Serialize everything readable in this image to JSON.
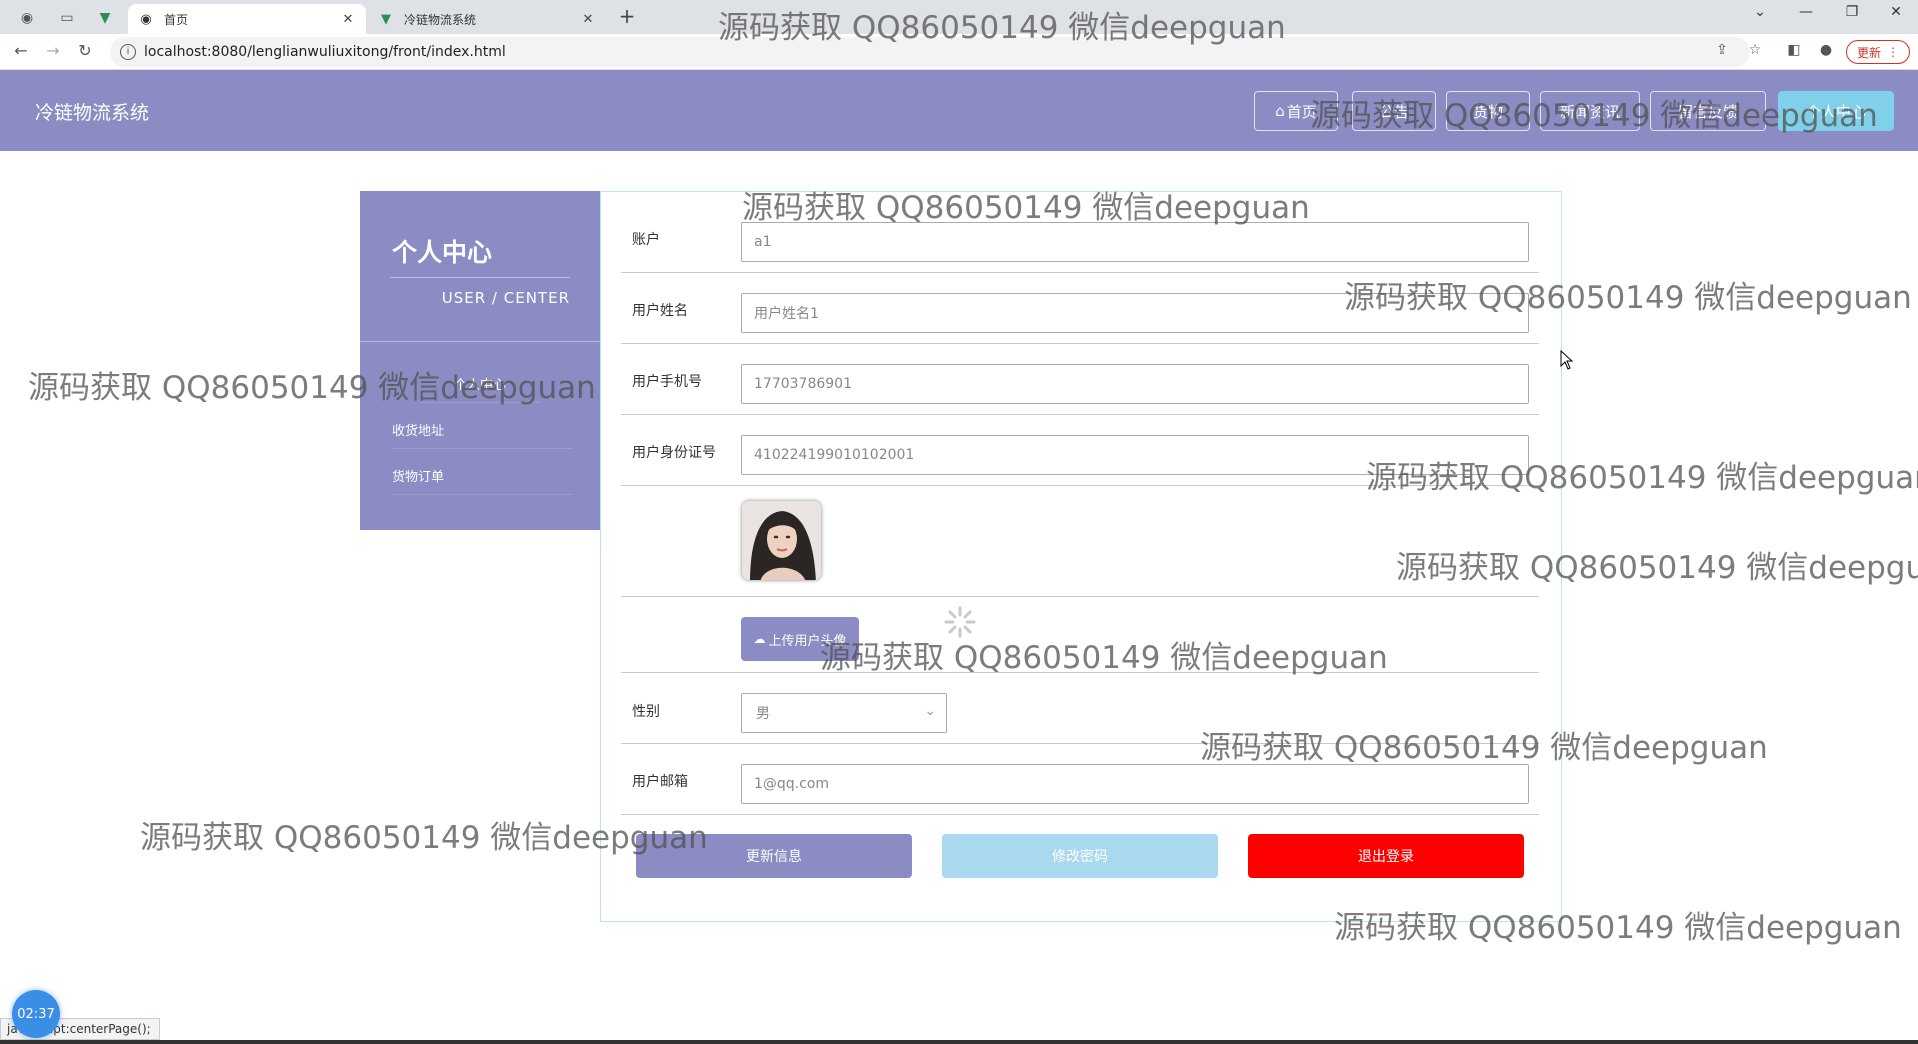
{
  "browser": {
    "tabs": [
      {
        "title": "首页",
        "active": true
      },
      {
        "title": "冷链物流系统",
        "active": false
      }
    ],
    "url": "localhost:8080/lenglianwuliuxitong/front/index.html",
    "update_label": "更新"
  },
  "header": {
    "site_title": "冷链物流系统",
    "nav": [
      {
        "label": "首页",
        "icon": "home-icon"
      },
      {
        "label": "公告"
      },
      {
        "label": "货物"
      },
      {
        "label": "新闻资讯"
      },
      {
        "label": "留言反馈"
      },
      {
        "label": "个人中心",
        "current": true
      }
    ]
  },
  "side": {
    "title": "个人中心",
    "subtitle": "USER / CENTER",
    "items": [
      {
        "label": "个人中心",
        "active": true
      },
      {
        "label": "收货地址"
      },
      {
        "label": "货物订单"
      }
    ]
  },
  "form": {
    "fields": [
      {
        "label": "账户",
        "value": "a1"
      },
      {
        "label": "用户姓名",
        "value": "用户姓名1"
      },
      {
        "label": "用户手机号",
        "value": "17703786901"
      },
      {
        "label": "用户身份证号",
        "value": "410224199010102001"
      }
    ],
    "upload_label": "上传用户头像",
    "gender": {
      "label": "性别",
      "value": "男"
    },
    "email": {
      "label": "用户邮箱",
      "value": "1@qq.com"
    },
    "actions": {
      "update": "更新信息",
      "change_password": "修改密码",
      "logout": "退出登录"
    }
  },
  "status_bar": {
    "link": "javascript:centerPage();"
  },
  "timer": "02:37",
  "watermark": "源码获取 QQ86050149 微信deepguan",
  "colors": {
    "header_bg": "#8a8cc3",
    "accent_light_blue": "#7fd0e8",
    "change_password_bg": "#a9d9ef",
    "logout_bg": "#ff0000"
  }
}
